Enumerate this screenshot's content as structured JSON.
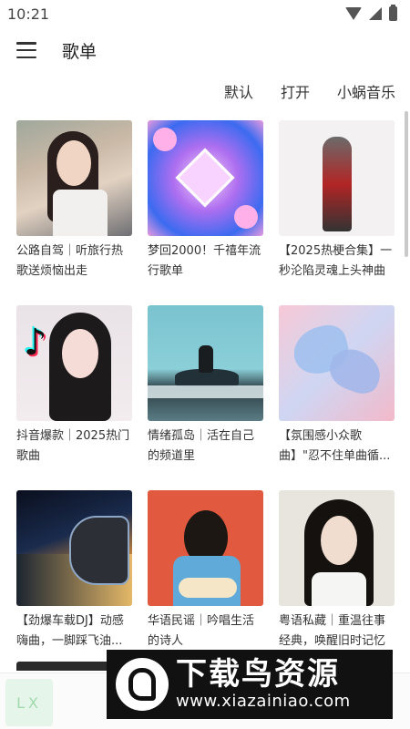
{
  "status_bar": {
    "time": "10:21"
  },
  "app_bar": {
    "title": "歌单"
  },
  "filters": [
    "默认",
    "打开",
    "小蜗音乐"
  ],
  "playlists": [
    {
      "title": "公路自驾｜听旅行热歌送烦恼出走"
    },
    {
      "title": "梦回2000！千禧年流行歌单"
    },
    {
      "title": "【2025热梗合集】一秒沦陷灵魂上头神曲"
    },
    {
      "title": "抖音爆款｜2025热门歌曲"
    },
    {
      "title": "情绪孤岛｜活在自己的频道里"
    },
    {
      "title": "【氛围感小众歌曲】\"忍不住单曲循..."
    },
    {
      "title": "【劲爆车载DJ】动感嗨曲，一脚踩飞油..."
    },
    {
      "title": "华语民谣｜吟唱生活的诗人"
    },
    {
      "title": "粤语私藏｜重温往事经典，唤醒旧时记忆"
    }
  ],
  "player": {
    "thumb_text": "LX"
  },
  "watermark": {
    "title": "下载鸟资源",
    "url": "www.xiazainiao.com"
  },
  "icons": {
    "menu": "menu-icon",
    "wifi": "wifi-icon",
    "signal": "signal-icon",
    "battery": "battery-icon"
  }
}
